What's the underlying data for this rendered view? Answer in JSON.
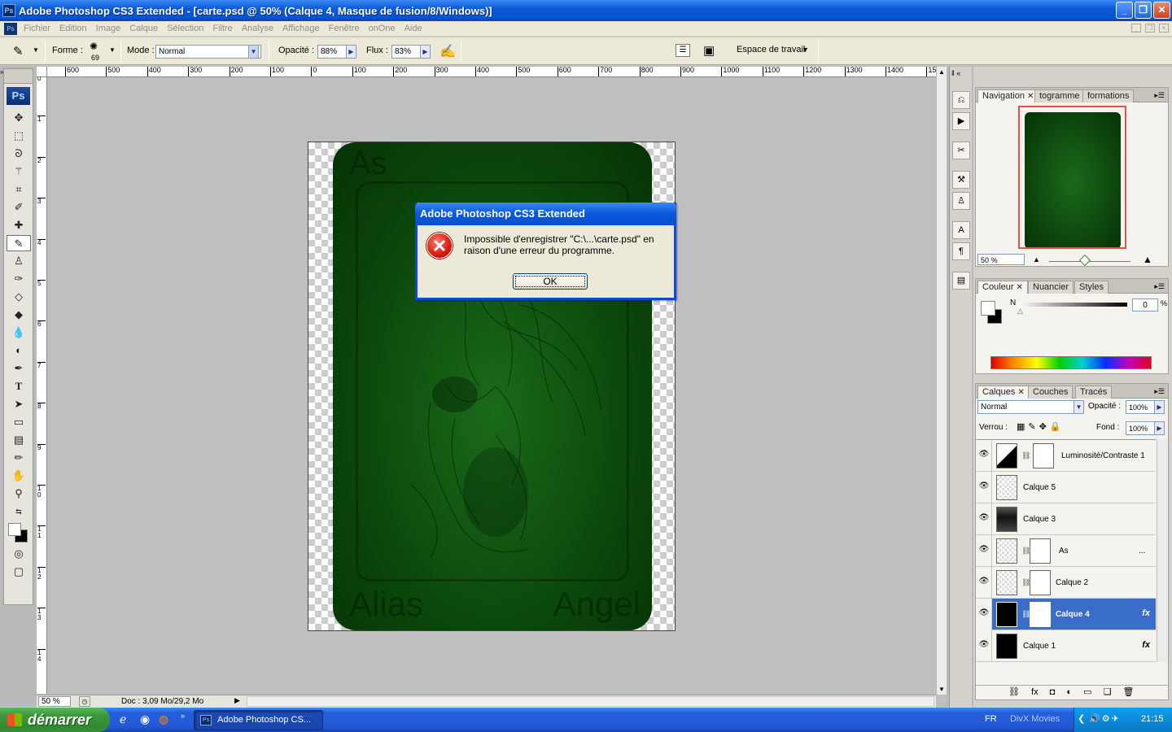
{
  "window": {
    "title": "Adobe Photoshop CS3 Extended - [carte.psd @ 50% (Calque 4, Masque de fusion/8/Windows)]",
    "app_icon_text": "Ps"
  },
  "menu": [
    "Fichier",
    "Edition",
    "Image",
    "Calque",
    "Sélection",
    "Filtre",
    "Analyse",
    "Affichage",
    "Fenêtre",
    "onOne",
    "Aide"
  ],
  "options_bar": {
    "forme_label": "Forme :",
    "brush_size": "69",
    "mode_label": "Mode :",
    "mode_value": "Normal",
    "opacite_label": "Opacité :",
    "opacite_value": "88%",
    "flux_label": "Flux :",
    "flux_value": "83%",
    "workspace_label": "Espace de travail"
  },
  "ruler_h": [
    "600",
    "500",
    "400",
    "300",
    "200",
    "100",
    "0",
    "100",
    "200",
    "300",
    "400",
    "500",
    "600",
    "700",
    "800",
    "900",
    "1000",
    "1100",
    "1200",
    "1300",
    "1400",
    "1500"
  ],
  "ruler_v": [
    "0",
    "1",
    "2",
    "3",
    "4",
    "5",
    "6",
    "7",
    "8",
    "9",
    "1 0",
    "1 1",
    "1 2",
    "1 3",
    "1 4"
  ],
  "status": {
    "zoom": "50 %",
    "doc_info": "Doc : 3,09 Mo/29,2 Mo"
  },
  "card": {
    "corner": "As",
    "bottom_left": "Alias",
    "bottom_right": "Angel",
    "colors": {
      "card_green": "#0c4a0c"
    }
  },
  "dialog": {
    "title": "Adobe Photoshop CS3 Extended",
    "message": "Impossible d'enregistrer \"C:\\...\\carte.psd\" en raison d'une erreur du programme.",
    "ok_label": "OK"
  },
  "navigator_panel": {
    "tabs": [
      "Navigation",
      "togramme",
      "formations"
    ],
    "zoom": "50 %"
  },
  "color_panel": {
    "tabs": [
      "Couleur",
      "Nuancier",
      "Styles"
    ],
    "channel_label": "N",
    "channel_value": "0",
    "unit": "%"
  },
  "layers_panel": {
    "tabs": [
      "Calques",
      "Couches",
      "Tracés"
    ],
    "blend_mode": "Normal",
    "opacity_label": "Opacité :",
    "opacity_value": "100%",
    "lock_label": "Verrou :",
    "fill_label": "Fond :",
    "fill_value": "100%",
    "layers": [
      {
        "name": "Luminosité/Contraste 1"
      },
      {
        "name": "Calque 5"
      },
      {
        "name": "Calque 3"
      },
      {
        "name": "As",
        "extra": "..."
      },
      {
        "name": "Calque 2"
      },
      {
        "name": "Calque 4",
        "selected": true
      },
      {
        "name": "Calque 1"
      }
    ]
  },
  "taskbar": {
    "start_label": "démarrer",
    "task_label": "Adobe Photoshop CS...",
    "lang": "FR",
    "divx": "DivX Movies",
    "time": "21:15"
  }
}
